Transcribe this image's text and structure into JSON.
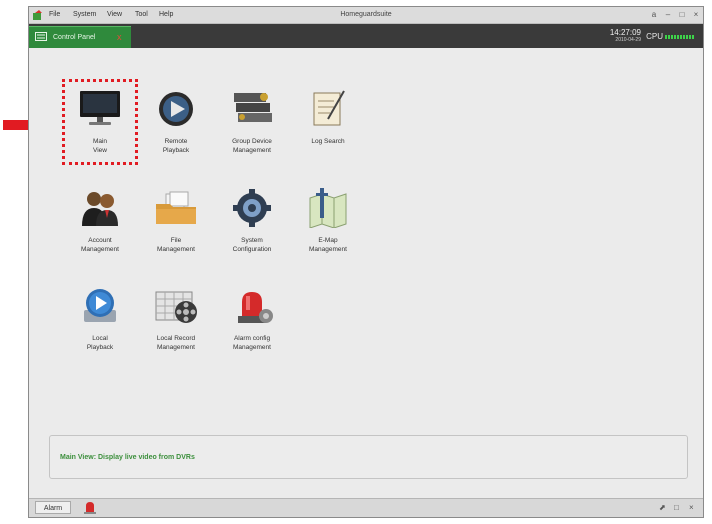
{
  "menubar": {
    "menus": [
      "File",
      "System",
      "View",
      "Tool",
      "Help"
    ],
    "title": "Homeguardsuite",
    "window_controls": [
      "a",
      "–",
      "□",
      "×"
    ]
  },
  "tabbar": {
    "tab_label": "Control Panel",
    "close_glyph": "x",
    "time": "14:27:09",
    "date": "2010-04-29",
    "cpu_label": "CPU"
  },
  "icons": [
    {
      "id": "main-view",
      "label": "Main\nView",
      "icon": "monitor-icon"
    },
    {
      "id": "remote-playback",
      "label": "Remote\nPlayback",
      "icon": "playback-icon"
    },
    {
      "id": "group-device",
      "label": "Group Device\nManagement",
      "icon": "dvr-devices-icon"
    },
    {
      "id": "log-search",
      "label": "Log Search",
      "icon": "log-icon"
    },
    {
      "id": "account",
      "label": "Account\nManagement",
      "icon": "users-icon"
    },
    {
      "id": "file",
      "label": "File\nManagement",
      "icon": "folder-icon"
    },
    {
      "id": "system-config",
      "label": "System\nConfiguration",
      "icon": "gear-icon"
    },
    {
      "id": "emap",
      "label": "E-Map\nManagement",
      "icon": "map-icon"
    },
    {
      "id": "local-playback",
      "label": "Local\nPlayback",
      "icon": "local-play-icon"
    },
    {
      "id": "local-record",
      "label": "Local Record\nManagement",
      "icon": "film-calendar-icon"
    },
    {
      "id": "alarm-config",
      "label": "Alarm config\nManagement",
      "icon": "alarm-light-icon"
    }
  ],
  "selected": "main-view",
  "description": "Main View: Display live video from DVRs",
  "statusbar": {
    "alarm_label": "Alarm",
    "buttons": [
      "⬈",
      "□",
      "×"
    ]
  },
  "colors": {
    "tab_green": "#2f8a3c",
    "highlight_red": "#e11b22",
    "desc_text": "#3c8f3c",
    "cpu_green": "#3ed34a"
  }
}
